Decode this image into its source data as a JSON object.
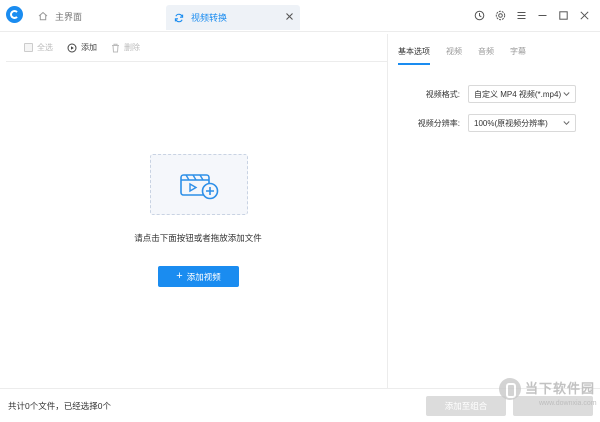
{
  "titlebar": {
    "home_tab": "主界面",
    "active_tab": "视频转换"
  },
  "toolbar": {
    "select_all": "全选",
    "add": "添加",
    "delete": "删除"
  },
  "main": {
    "hint": "请点击下面按钮或者拖放添加文件",
    "add_video_button": "添加视频"
  },
  "settings": {
    "tabs": [
      "基本选项",
      "视频",
      "音频",
      "字幕"
    ],
    "active_tab_index": 0,
    "format_label": "视频格式:",
    "format_value": "自定义 MP4 视频(*.mp4)",
    "resolution_label": "视频分辨率:",
    "resolution_value": "100%(原视频分辨率)"
  },
  "footer": {
    "status": "共计0个文件，已经选择0个",
    "merge_button": "添加至组合"
  },
  "watermark": {
    "name": "当下软件园",
    "url": "www.downxia.com"
  },
  "colors": {
    "accent": "#1a8cf0",
    "disabled_button": "#dcdcdc"
  }
}
